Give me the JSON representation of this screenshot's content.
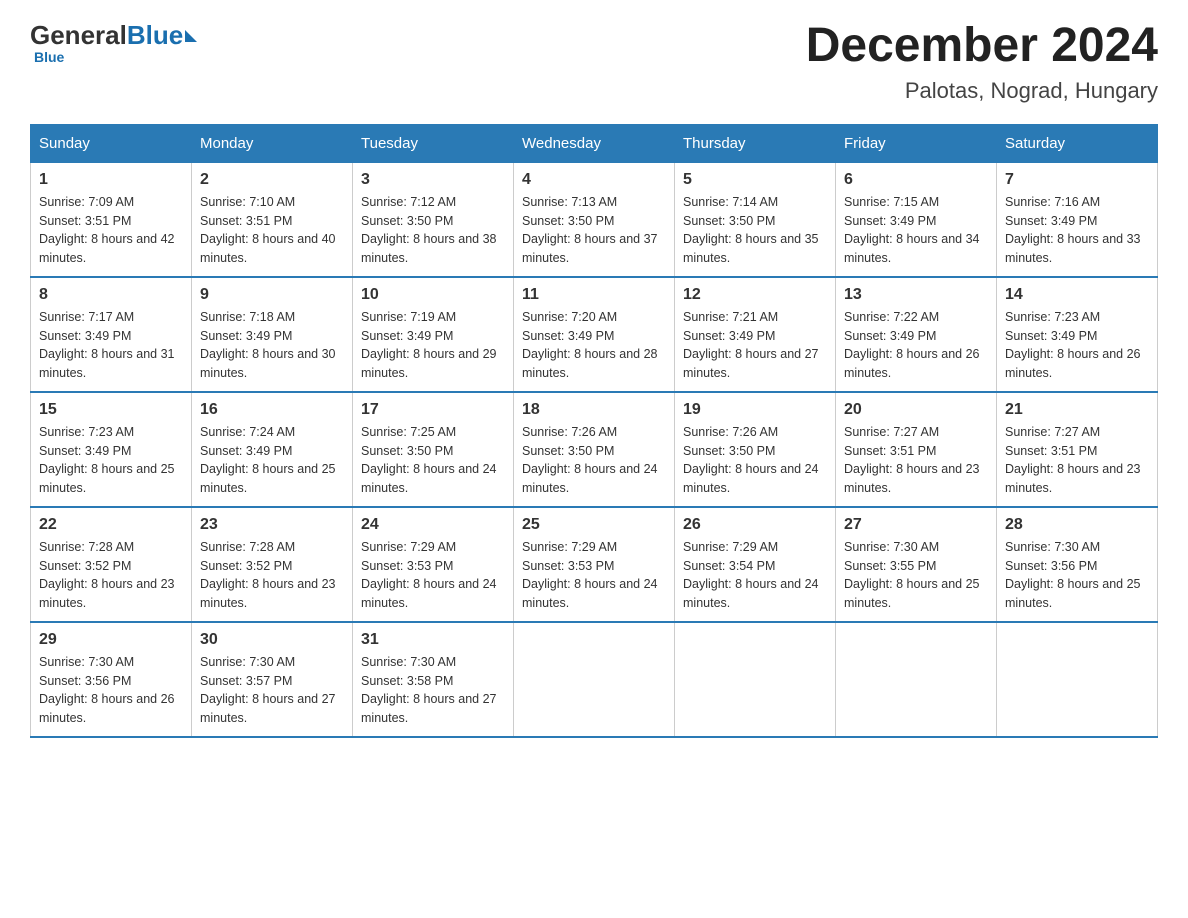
{
  "header": {
    "logo_general": "General",
    "logo_blue": "Blue",
    "month_title": "December 2024",
    "location": "Palotas, Nograd, Hungary"
  },
  "days_of_week": [
    "Sunday",
    "Monday",
    "Tuesday",
    "Wednesday",
    "Thursday",
    "Friday",
    "Saturday"
  ],
  "weeks": [
    [
      {
        "day": "1",
        "sunrise": "Sunrise: 7:09 AM",
        "sunset": "Sunset: 3:51 PM",
        "daylight": "Daylight: 8 hours and 42 minutes."
      },
      {
        "day": "2",
        "sunrise": "Sunrise: 7:10 AM",
        "sunset": "Sunset: 3:51 PM",
        "daylight": "Daylight: 8 hours and 40 minutes."
      },
      {
        "day": "3",
        "sunrise": "Sunrise: 7:12 AM",
        "sunset": "Sunset: 3:50 PM",
        "daylight": "Daylight: 8 hours and 38 minutes."
      },
      {
        "day": "4",
        "sunrise": "Sunrise: 7:13 AM",
        "sunset": "Sunset: 3:50 PM",
        "daylight": "Daylight: 8 hours and 37 minutes."
      },
      {
        "day": "5",
        "sunrise": "Sunrise: 7:14 AM",
        "sunset": "Sunset: 3:50 PM",
        "daylight": "Daylight: 8 hours and 35 minutes."
      },
      {
        "day": "6",
        "sunrise": "Sunrise: 7:15 AM",
        "sunset": "Sunset: 3:49 PM",
        "daylight": "Daylight: 8 hours and 34 minutes."
      },
      {
        "day": "7",
        "sunrise": "Sunrise: 7:16 AM",
        "sunset": "Sunset: 3:49 PM",
        "daylight": "Daylight: 8 hours and 33 minutes."
      }
    ],
    [
      {
        "day": "8",
        "sunrise": "Sunrise: 7:17 AM",
        "sunset": "Sunset: 3:49 PM",
        "daylight": "Daylight: 8 hours and 31 minutes."
      },
      {
        "day": "9",
        "sunrise": "Sunrise: 7:18 AM",
        "sunset": "Sunset: 3:49 PM",
        "daylight": "Daylight: 8 hours and 30 minutes."
      },
      {
        "day": "10",
        "sunrise": "Sunrise: 7:19 AM",
        "sunset": "Sunset: 3:49 PM",
        "daylight": "Daylight: 8 hours and 29 minutes."
      },
      {
        "day": "11",
        "sunrise": "Sunrise: 7:20 AM",
        "sunset": "Sunset: 3:49 PM",
        "daylight": "Daylight: 8 hours and 28 minutes."
      },
      {
        "day": "12",
        "sunrise": "Sunrise: 7:21 AM",
        "sunset": "Sunset: 3:49 PM",
        "daylight": "Daylight: 8 hours and 27 minutes."
      },
      {
        "day": "13",
        "sunrise": "Sunrise: 7:22 AM",
        "sunset": "Sunset: 3:49 PM",
        "daylight": "Daylight: 8 hours and 26 minutes."
      },
      {
        "day": "14",
        "sunrise": "Sunrise: 7:23 AM",
        "sunset": "Sunset: 3:49 PM",
        "daylight": "Daylight: 8 hours and 26 minutes."
      }
    ],
    [
      {
        "day": "15",
        "sunrise": "Sunrise: 7:23 AM",
        "sunset": "Sunset: 3:49 PM",
        "daylight": "Daylight: 8 hours and 25 minutes."
      },
      {
        "day": "16",
        "sunrise": "Sunrise: 7:24 AM",
        "sunset": "Sunset: 3:49 PM",
        "daylight": "Daylight: 8 hours and 25 minutes."
      },
      {
        "day": "17",
        "sunrise": "Sunrise: 7:25 AM",
        "sunset": "Sunset: 3:50 PM",
        "daylight": "Daylight: 8 hours and 24 minutes."
      },
      {
        "day": "18",
        "sunrise": "Sunrise: 7:26 AM",
        "sunset": "Sunset: 3:50 PM",
        "daylight": "Daylight: 8 hours and 24 minutes."
      },
      {
        "day": "19",
        "sunrise": "Sunrise: 7:26 AM",
        "sunset": "Sunset: 3:50 PM",
        "daylight": "Daylight: 8 hours and 24 minutes."
      },
      {
        "day": "20",
        "sunrise": "Sunrise: 7:27 AM",
        "sunset": "Sunset: 3:51 PM",
        "daylight": "Daylight: 8 hours and 23 minutes."
      },
      {
        "day": "21",
        "sunrise": "Sunrise: 7:27 AM",
        "sunset": "Sunset: 3:51 PM",
        "daylight": "Daylight: 8 hours and 23 minutes."
      }
    ],
    [
      {
        "day": "22",
        "sunrise": "Sunrise: 7:28 AM",
        "sunset": "Sunset: 3:52 PM",
        "daylight": "Daylight: 8 hours and 23 minutes."
      },
      {
        "day": "23",
        "sunrise": "Sunrise: 7:28 AM",
        "sunset": "Sunset: 3:52 PM",
        "daylight": "Daylight: 8 hours and 23 minutes."
      },
      {
        "day": "24",
        "sunrise": "Sunrise: 7:29 AM",
        "sunset": "Sunset: 3:53 PM",
        "daylight": "Daylight: 8 hours and 24 minutes."
      },
      {
        "day": "25",
        "sunrise": "Sunrise: 7:29 AM",
        "sunset": "Sunset: 3:53 PM",
        "daylight": "Daylight: 8 hours and 24 minutes."
      },
      {
        "day": "26",
        "sunrise": "Sunrise: 7:29 AM",
        "sunset": "Sunset: 3:54 PM",
        "daylight": "Daylight: 8 hours and 24 minutes."
      },
      {
        "day": "27",
        "sunrise": "Sunrise: 7:30 AM",
        "sunset": "Sunset: 3:55 PM",
        "daylight": "Daylight: 8 hours and 25 minutes."
      },
      {
        "day": "28",
        "sunrise": "Sunrise: 7:30 AM",
        "sunset": "Sunset: 3:56 PM",
        "daylight": "Daylight: 8 hours and 25 minutes."
      }
    ],
    [
      {
        "day": "29",
        "sunrise": "Sunrise: 7:30 AM",
        "sunset": "Sunset: 3:56 PM",
        "daylight": "Daylight: 8 hours and 26 minutes."
      },
      {
        "day": "30",
        "sunrise": "Sunrise: 7:30 AM",
        "sunset": "Sunset: 3:57 PM",
        "daylight": "Daylight: 8 hours and 27 minutes."
      },
      {
        "day": "31",
        "sunrise": "Sunrise: 7:30 AM",
        "sunset": "Sunset: 3:58 PM",
        "daylight": "Daylight: 8 hours and 27 minutes."
      },
      {
        "day": "",
        "sunrise": "",
        "sunset": "",
        "daylight": ""
      },
      {
        "day": "",
        "sunrise": "",
        "sunset": "",
        "daylight": ""
      },
      {
        "day": "",
        "sunrise": "",
        "sunset": "",
        "daylight": ""
      },
      {
        "day": "",
        "sunrise": "",
        "sunset": "",
        "daylight": ""
      }
    ]
  ]
}
